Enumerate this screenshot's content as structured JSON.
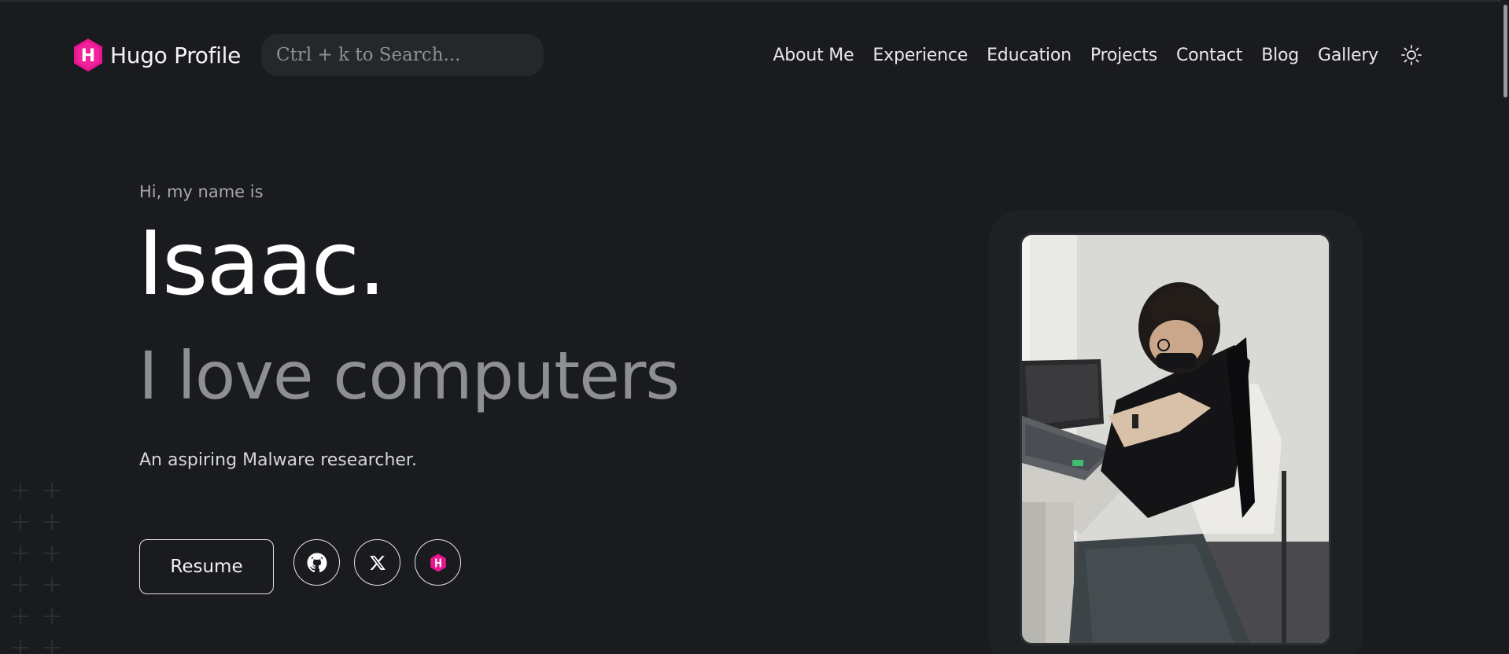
{
  "navbar": {
    "brand": "Hugo Profile",
    "brand_logo_letter": "H",
    "search_placeholder": "Ctrl + k to Search...",
    "links": [
      "About Me",
      "Experience",
      "Education",
      "Projects",
      "Contact",
      "Blog",
      "Gallery"
    ],
    "theme_icon": "sun-icon"
  },
  "hero": {
    "greeting": "Hi, my name is",
    "name": "Isaac.",
    "tagline": "I love computers",
    "description": "An aspiring Malware researcher.",
    "resume_label": "Resume",
    "socials": [
      "github-icon",
      "x-twitter-icon",
      "hugo-icon"
    ]
  },
  "colors": {
    "background": "#1a1b1e",
    "accent_pink": "#e9148f",
    "text_primary": "#ffffff",
    "text_muted": "#8e8f91"
  }
}
